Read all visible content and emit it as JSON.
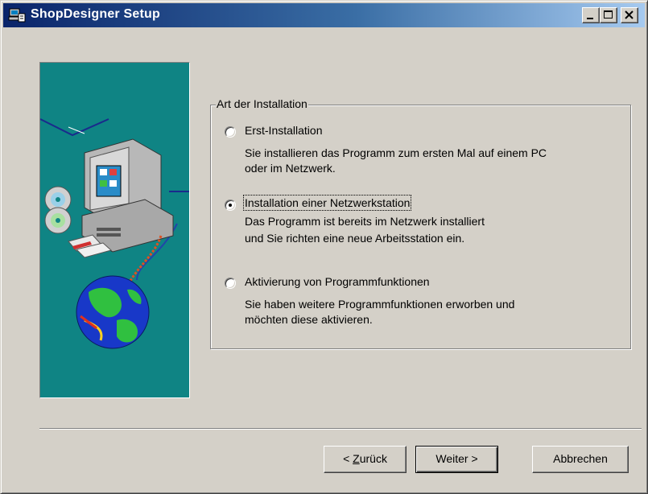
{
  "window": {
    "title": "ShopDesigner Setup",
    "icon": "setup-app-icon",
    "controls": {
      "minimize": "minimize-icon",
      "maximize": "maximize-icon",
      "close": "close-icon"
    }
  },
  "group": {
    "legend": "Art der Installation",
    "options": [
      {
        "label": "Erst-Installation",
        "checked": false,
        "desc_lines": [
          "Sie installieren das Programm zum ersten Mal auf einem PC",
          "oder im Netzwerk."
        ]
      },
      {
        "label": "Installation einer Netzwerkstation",
        "checked": true,
        "desc_lines": [
          "Das Programm ist bereits im Netzwerk installiert",
          "und Sie richten eine neue Arbeitsstation ein."
        ]
      },
      {
        "label": "Aktivierung von Programmfunktionen",
        "checked": false,
        "desc_lines": [
          "Sie haben weitere Programmfunktionen erworben und",
          "möchten diese aktivieren."
        ]
      }
    ]
  },
  "buttons": {
    "back_prefix": "< ",
    "back_mnemonic": "Z",
    "back_rest": "urück",
    "next": "Weiter >",
    "cancel": "Abbrechen"
  },
  "colors": {
    "panel_bg": "#0f8484",
    "titlebar_start": "#0a246a",
    "titlebar_end": "#a6caf0",
    "face": "#d4d0c8"
  }
}
